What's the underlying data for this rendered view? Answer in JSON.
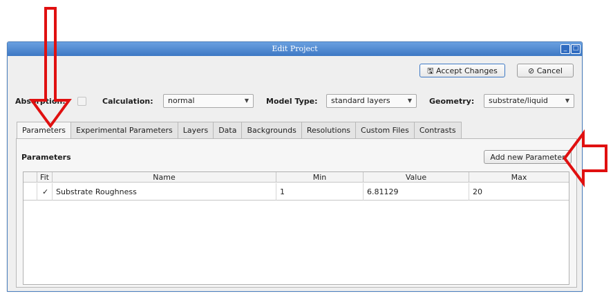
{
  "window": {
    "title": "Edit Project"
  },
  "toolbar": {
    "accept_label": "Accept Changes",
    "cancel_label": "Cancel"
  },
  "options": {
    "absorption_label": "Absorption:",
    "calculation_label": "Calculation:",
    "calculation_value": "normal",
    "model_type_label": "Model Type:",
    "model_type_value": "standard layers",
    "geometry_label": "Geometry:",
    "geometry_value": "substrate/liquid"
  },
  "tabs": [
    "Parameters",
    "Experimental Parameters",
    "Layers",
    "Data",
    "Backgrounds",
    "Resolutions",
    "Custom Files",
    "Contrasts"
  ],
  "panel": {
    "heading": "Parameters",
    "add_button": "Add new Parameter"
  },
  "table": {
    "headers": [
      "Fit",
      "Name",
      "Min",
      "Value",
      "Max"
    ],
    "rows": [
      {
        "fit": true,
        "fit_mark": "✓",
        "name": "Substrate Roughness",
        "min": "1",
        "value": "6.81129",
        "max": "20"
      }
    ]
  },
  "annotations": {
    "arrow_color": "#e01010"
  }
}
